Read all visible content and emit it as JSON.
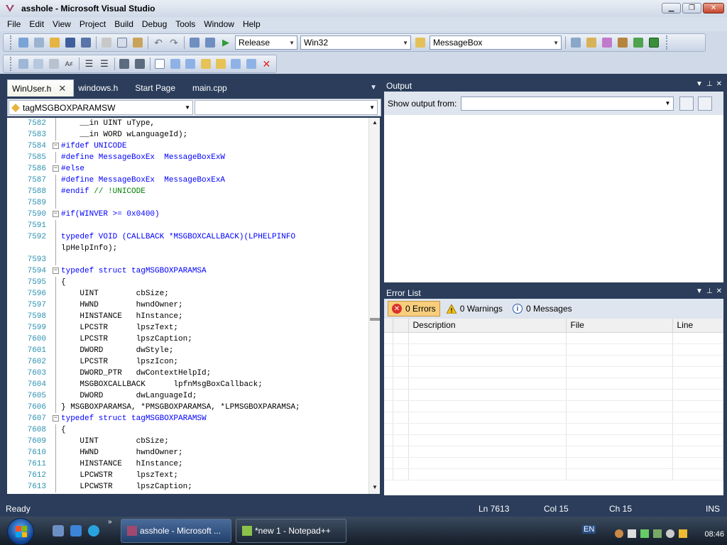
{
  "window": {
    "title": "asshole - Microsoft Visual Studio"
  },
  "menu": [
    "File",
    "Edit",
    "View",
    "Project",
    "Build",
    "Debug",
    "Tools",
    "Window",
    "Help"
  ],
  "toolbar": {
    "config": "Release",
    "platform": "Win32",
    "find_text": "MessageBox"
  },
  "editor": {
    "tabs": [
      "WinUser.h",
      "windows.h",
      "Start Page",
      "main.cpp"
    ],
    "active_tab": "WinUser.h",
    "nav_scope": "tagMSGBOXPARAMSW",
    "nav_member": "",
    "lines": [
      {
        "n": "7582",
        "text": "    __in UINT uType,"
      },
      {
        "n": "7583",
        "text": "    __in WORD wLanguageId);"
      },
      {
        "n": "7584",
        "text": "#ifdef UNICODE",
        "fold": "-"
      },
      {
        "n": "7585",
        "text": "#define MessageBoxEx  MessageBoxExW"
      },
      {
        "n": "7586",
        "text": "#else",
        "fold": "-"
      },
      {
        "n": "7587",
        "text": "#define MessageBoxEx  MessageBoxExA"
      },
      {
        "n": "7588",
        "text": "#endif // !UNICODE"
      },
      {
        "n": "7589",
        "text": ""
      },
      {
        "n": "7590",
        "text": "#if(WINVER >= 0x0400)",
        "fold": "-"
      },
      {
        "n": "7591",
        "text": ""
      },
      {
        "n": "7592",
        "text": "typedef VOID (CALLBACK *MSGBOXCALLBACK)(LPHELPINFO"
      },
      {
        "n": "",
        "text": "lpHelpInfo);"
      },
      {
        "n": "7593",
        "text": ""
      },
      {
        "n": "7594",
        "text": "typedef struct tagMSGBOXPARAMSA",
        "fold": "-"
      },
      {
        "n": "7595",
        "text": "{"
      },
      {
        "n": "7596",
        "text": "    UINT        cbSize;"
      },
      {
        "n": "7597",
        "text": "    HWND        hwndOwner;"
      },
      {
        "n": "7598",
        "text": "    HINSTANCE   hInstance;"
      },
      {
        "n": "7599",
        "text": "    LPCSTR      lpszText;"
      },
      {
        "n": "7600",
        "text": "    LPCSTR      lpszCaption;"
      },
      {
        "n": "7601",
        "text": "    DWORD       dwStyle;"
      },
      {
        "n": "7602",
        "text": "    LPCSTR      lpszIcon;"
      },
      {
        "n": "7603",
        "text": "    DWORD_PTR   dwContextHelpId;"
      },
      {
        "n": "7604",
        "text": "    MSGBOXCALLBACK      lpfnMsgBoxCallback;"
      },
      {
        "n": "7605",
        "text": "    DWORD       dwLanguageId;"
      },
      {
        "n": "7606",
        "text": "} MSGBOXPARAMSA, *PMSGBOXPARAMSA, *LPMSGBOXPARAMSA;"
      },
      {
        "n": "7607",
        "text": "typedef struct tagMSGBOXPARAMSW",
        "fold": "-"
      },
      {
        "n": "7608",
        "text": "{"
      },
      {
        "n": "7609",
        "text": "    UINT        cbSize;"
      },
      {
        "n": "7610",
        "text": "    HWND        hwndOwner;"
      },
      {
        "n": "7611",
        "text": "    HINSTANCE   hInstance;"
      },
      {
        "n": "7612",
        "text": "    LPCWSTR     lpszText;"
      },
      {
        "n": "7613",
        "text": "    LPCWSTR     lpszCaption;"
      }
    ]
  },
  "output": {
    "title": "Output",
    "show_label": "Show output from:",
    "source": ""
  },
  "errors": {
    "title": "Error List",
    "errors_label": "0 Errors",
    "warnings_label": "0 Warnings",
    "messages_label": "0 Messages",
    "columns": [
      "Description",
      "File",
      "Line"
    ]
  },
  "status": {
    "state": "Ready",
    "ln": "Ln 7613",
    "col": "Col 15",
    "ch": "Ch 15",
    "mode": "INS"
  },
  "taskbar": {
    "buttons": [
      "asshole - Microsoft ...",
      "*new  1 - Notepad++"
    ],
    "lang": "EN",
    "time": "08:46"
  }
}
